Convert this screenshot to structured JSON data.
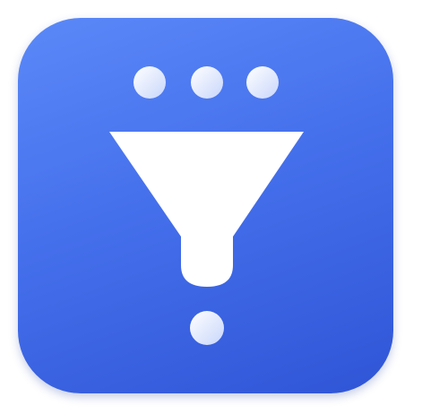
{
  "app_icon": {
    "name": "filter-funnel-app-icon",
    "background_colors": [
      "#5b89f8",
      "#4570ec",
      "#2f55d6"
    ],
    "glyph_color": "#ffffff",
    "dot_colors": [
      "#ffffff",
      "#c8d6fb"
    ]
  }
}
